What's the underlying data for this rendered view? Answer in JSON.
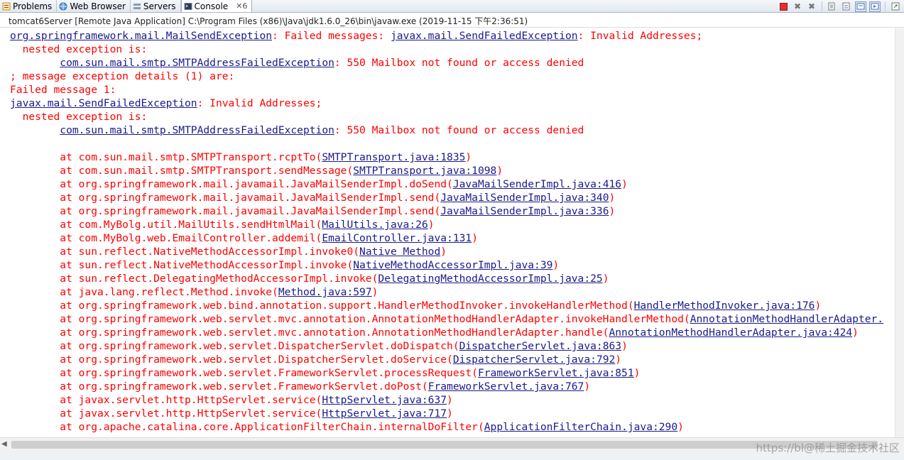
{
  "tabs": [
    {
      "name": "problems",
      "label": "Problems",
      "icon": "problems-icon",
      "active": false
    },
    {
      "name": "web-browser",
      "label": "Web Browser",
      "icon": "globe-icon",
      "active": false
    },
    {
      "name": "servers",
      "label": "Servers",
      "icon": "servers-icon",
      "active": false
    },
    {
      "name": "console",
      "label": "Console",
      "icon": "console-icon",
      "active": true,
      "close": "✕6"
    }
  ],
  "toolbar": {
    "terminate_icon": "stop-icon",
    "remove_launch_icon": "remove-icon",
    "remove_all_icon": "remove-all-icon",
    "scroll_lock_icon": "scroll-lock-icon",
    "pin_icon": "pin-icon",
    "display_selected_icon": "display-console-icon",
    "open_console_icon": "open-console-icon",
    "accent": "#e03030"
  },
  "status": {
    "text": "tomcat6Server [Remote Java Application] C:\\Program Files (x86)\\Java\\jdk1.6.0_26\\bin\\javaw.exe (2019-11-15 下午2:36:51)"
  },
  "console": {
    "error_color": "#ff0000",
    "link_color": "#1a1a8c",
    "lines": [
      [
        {
          "l": "org.springframework.mail.MailSendException"
        },
        {
          "t": ": Failed messages: "
        },
        {
          "l": "javax.mail.SendFailedException"
        },
        {
          "t": ": Invalid Addresses;"
        }
      ],
      [
        {
          "t": "  nested exception is:"
        }
      ],
      [
        {
          "t": "        "
        },
        {
          "l": "com.sun.mail.smtp.SMTPAddressFailedException"
        },
        {
          "t": ": 550 Mailbox not found or access denied"
        }
      ],
      [
        {
          "t": "; message exception details (1) are:"
        }
      ],
      [
        {
          "t": "Failed message 1:"
        }
      ],
      [
        {
          "l": "javax.mail.SendFailedException"
        },
        {
          "t": ": Invalid Addresses;"
        }
      ],
      [
        {
          "t": "  nested exception is:"
        }
      ],
      [
        {
          "t": "        "
        },
        {
          "l": "com.sun.mail.smtp.SMTPAddressFailedException"
        },
        {
          "t": ": 550 Mailbox not found or access denied"
        }
      ],
      [
        {
          "t": ""
        }
      ],
      [
        {
          "t": "        at com.sun.mail.smtp.SMTPTransport.rcptTo("
        },
        {
          "l": "SMTPTransport.java:1835"
        },
        {
          "t": ")"
        }
      ],
      [
        {
          "t": "        at com.sun.mail.smtp.SMTPTransport.sendMessage("
        },
        {
          "l": "SMTPTransport.java:1098"
        },
        {
          "t": ")"
        }
      ],
      [
        {
          "t": "        at org.springframework.mail.javamail.JavaMailSenderImpl.doSend("
        },
        {
          "l": "JavaMailSenderImpl.java:416"
        },
        {
          "t": ")"
        }
      ],
      [
        {
          "t": "        at org.springframework.mail.javamail.JavaMailSenderImpl.send("
        },
        {
          "l": "JavaMailSenderImpl.java:340"
        },
        {
          "t": ")"
        }
      ],
      [
        {
          "t": "        at org.springframework.mail.javamail.JavaMailSenderImpl.send("
        },
        {
          "l": "JavaMailSenderImpl.java:336"
        },
        {
          "t": ")"
        }
      ],
      [
        {
          "t": "        at com.MyBolg.util.MailUtils.sendHtmlMail("
        },
        {
          "l": "MailUtils.java:26"
        },
        {
          "t": ")"
        }
      ],
      [
        {
          "t": "        at com.MyBolg.web.EmailController.addemil("
        },
        {
          "l": "EmailController.java:131"
        },
        {
          "t": ")"
        }
      ],
      [
        {
          "t": "        at sun.reflect.NativeMethodAccessorImpl.invoke0("
        },
        {
          "l": "Native Method"
        },
        {
          "t": ")"
        }
      ],
      [
        {
          "t": "        at sun.reflect.NativeMethodAccessorImpl.invoke("
        },
        {
          "l": "NativeMethodAccessorImpl.java:39"
        },
        {
          "t": ")"
        }
      ],
      [
        {
          "t": "        at sun.reflect.DelegatingMethodAccessorImpl.invoke("
        },
        {
          "l": "DelegatingMethodAccessorImpl.java:25"
        },
        {
          "t": ")"
        }
      ],
      [
        {
          "t": "        at java.lang.reflect.Method.invoke("
        },
        {
          "l": "Method.java:597"
        },
        {
          "t": ")"
        }
      ],
      [
        {
          "t": "        at org.springframework.web.bind.annotation.support.HandlerMethodInvoker.invokeHandlerMethod("
        },
        {
          "l": "HandlerMethodInvoker.java:176"
        },
        {
          "t": ")"
        }
      ],
      [
        {
          "t": "        at org.springframework.web.servlet.mvc.annotation.AnnotationMethodHandlerAdapter.invokeHandlerMethod("
        },
        {
          "l": "AnnotationMethodHandlerAdapter."
        }
      ],
      [
        {
          "t": "        at org.springframework.web.servlet.mvc.annotation.AnnotationMethodHandlerAdapter.handle("
        },
        {
          "l": "AnnotationMethodHandlerAdapter.java:424"
        },
        {
          "t": ")"
        }
      ],
      [
        {
          "t": "        at org.springframework.web.servlet.DispatcherServlet.doDispatch("
        },
        {
          "l": "DispatcherServlet.java:863"
        },
        {
          "t": ")"
        }
      ],
      [
        {
          "t": "        at org.springframework.web.servlet.DispatcherServlet.doService("
        },
        {
          "l": "DispatcherServlet.java:792"
        },
        {
          "t": ")"
        }
      ],
      [
        {
          "t": "        at org.springframework.web.servlet.FrameworkServlet.processRequest("
        },
        {
          "l": "FrameworkServlet.java:851"
        },
        {
          "t": ")"
        }
      ],
      [
        {
          "t": "        at org.springframework.web.servlet.FrameworkServlet.doPost("
        },
        {
          "l": "FrameworkServlet.java:767"
        },
        {
          "t": ")"
        }
      ],
      [
        {
          "t": "        at javax.servlet.http.HttpServlet.service("
        },
        {
          "l": "HttpServlet.java:637"
        },
        {
          "t": ")"
        }
      ],
      [
        {
          "t": "        at javax.servlet.http.HttpServlet.service("
        },
        {
          "l": "HttpServlet.java:717"
        },
        {
          "t": ")"
        }
      ],
      [
        {
          "t": "        at org.apache.catalina.core.ApplicationFilterChain.internalDoFilter("
        },
        {
          "l": "ApplicationFilterChain.java:290"
        },
        {
          "t": ")"
        }
      ]
    ]
  },
  "watermark": "https://bl@稀土掘金技术社区"
}
